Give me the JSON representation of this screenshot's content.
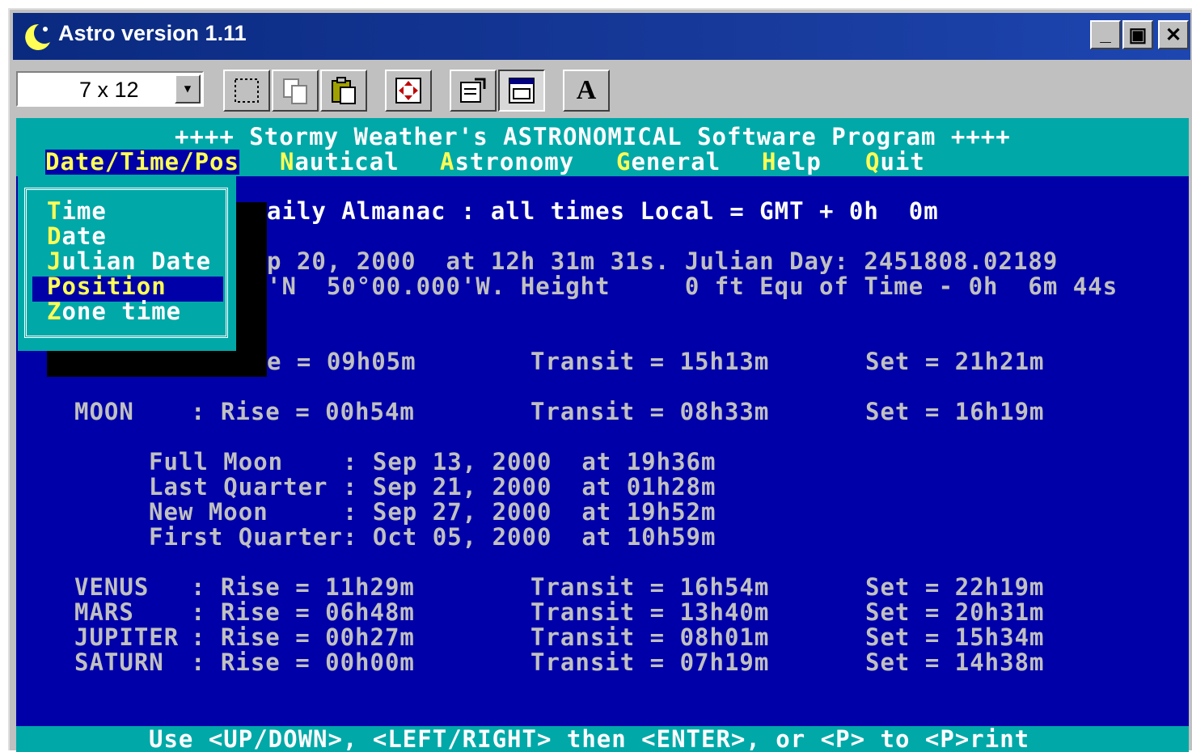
{
  "window": {
    "title": "Astro version 1.11",
    "buttons": {
      "minimize": "_",
      "restore": "▣",
      "close": "✕"
    }
  },
  "toolbar": {
    "font_size": "7 x 12",
    "buttons": [
      "mark-icon",
      "copy-icon",
      "paste-icon",
      "fullscreen-icon",
      "properties-icon",
      "background-icon",
      "font-icon"
    ],
    "font_button_label": "A"
  },
  "console": {
    "header": "++++ Stormy Weather's ASTRONOMICAL Software Program ++++",
    "menu": [
      {
        "label": "Date/Time/Pos",
        "hot": "D",
        "rest": "ate/Time/Pos",
        "selected": true
      },
      {
        "label": "Nautical",
        "hot": "N",
        "rest": "autical"
      },
      {
        "label": "Astronomy",
        "hot": "A",
        "rest": "stronomy"
      },
      {
        "label": "General",
        "hot": "G",
        "rest": "eneral"
      },
      {
        "label": "Help",
        "hot": "H",
        "rest": "elp"
      },
      {
        "label": "Quit",
        "hot": "Q",
        "rest": "uit"
      }
    ],
    "dropdown": [
      {
        "hot": "T",
        "rest": "ime"
      },
      {
        "hot": "D",
        "rest": "ate"
      },
      {
        "hot": "J",
        "rest": "ulian Date"
      },
      {
        "hot": "P",
        "rest": "osition",
        "selected": true
      },
      {
        "hot": "Z",
        "rest": "one time"
      }
    ],
    "line_almanac": "aily Almanac : all times Local = GMT + 0h  0m",
    "line_date": "p 20, 2000  at 12h 31m 31s. Julian Day: 2451808.02189",
    "line_pos": "'N  50°00.000'W. Height     0 ft Equ of Time - 0h  6m 44s",
    "sun": {
      "rise_tail": "e = 09h05m",
      "transit": "Transit = 15h13m",
      "set": "Set = 21h21m"
    },
    "moon": {
      "name": "MOON",
      "rise": ": Rise = 00h54m",
      "transit": "Transit = 08h33m",
      "set": "Set = 16h19m"
    },
    "phases": [
      "Full Moon    : Sep 13, 2000  at 19h36m",
      "Last Quarter : Sep 21, 2000  at 01h28m",
      "New Moon     : Sep 27, 2000  at 19h52m",
      "First Quarter: Oct 05, 2000  at 10h59m"
    ],
    "planets": [
      {
        "name": "VENUS  ",
        "rise": ": Rise = 11h29m",
        "transit": "Transit = 16h54m",
        "set": "Set = 22h19m"
      },
      {
        "name": "MARS   ",
        "rise": ": Rise = 06h48m",
        "transit": "Transit = 13h40m",
        "set": "Set = 20h31m"
      },
      {
        "name": "JUPITER",
        "rise": ": Rise = 00h27m",
        "transit": "Transit = 08h01m",
        "set": "Set = 15h34m"
      },
      {
        "name": "SATURN ",
        "rise": ": Rise = 00h00m",
        "transit": "Transit = 07h19m",
        "set": "Set = 14h38m"
      }
    ],
    "status": "Use <UP/DOWN>, <LEFT/RIGHT> then <ENTER>, or <P> to <P>rint"
  },
  "colors": {
    "console_bg": "#0000a8",
    "teal": "#00a8a8",
    "hotkey": "#ffff55",
    "title_bar": "#0a2a80"
  }
}
